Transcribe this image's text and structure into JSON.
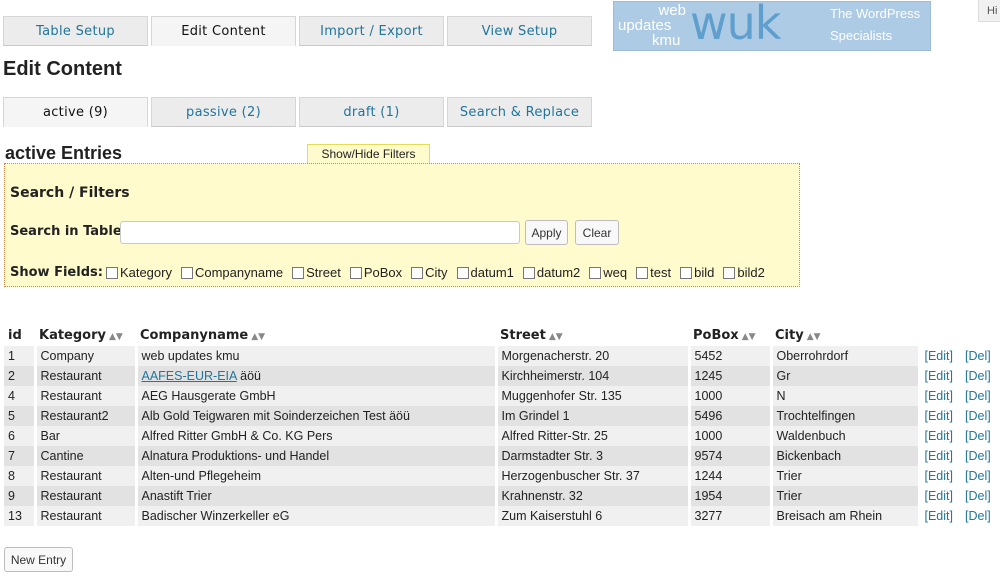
{
  "tabs_top": [
    "Table Setup",
    "Edit Content",
    "Import / Export",
    "View Setup"
  ],
  "tabs_top_active": 1,
  "banner": {
    "logo_web": "web",
    "logo_updates": "updates",
    "logo_kmu": "kmu",
    "logo_wuk": "wuk",
    "tagline_1": "The WordPress",
    "tagline_2": "Specialists"
  },
  "hide_label": "Hi",
  "page_title": "Edit Content",
  "tabs_sub": [
    "active (9)",
    "passive (2)",
    "draft (1)",
    "Search & Replace"
  ],
  "tabs_sub_active": 0,
  "section_title": "active Entries",
  "toggle_filters": "Show/Hide Filters",
  "filters": {
    "heading": "Search / Filters",
    "search_label": "Search in Table:",
    "search_value": "",
    "apply": "Apply",
    "clear": "Clear",
    "fields_label": "Show Fields:",
    "fields": [
      "Kategory",
      "Companyname",
      "Street",
      "PoBox",
      "City",
      "datum1",
      "datum2",
      "weq",
      "test",
      "bild",
      "bild2"
    ]
  },
  "table": {
    "headers": [
      "id",
      "Kategory",
      "Companyname",
      "Street",
      "PoBox",
      "City"
    ],
    "sortable": [
      false,
      true,
      true,
      true,
      true,
      true
    ],
    "edit_label": "[Edit]",
    "del_label": "[Del]",
    "rows": [
      {
        "id": "1",
        "kategory": "Company",
        "company": "web updates kmu",
        "company_link": "",
        "street": "Morgenacherstr. 20",
        "pobox": "5452",
        "city": "Oberrohrdorf"
      },
      {
        "id": "2",
        "kategory": "Restaurant",
        "company": " äöü",
        "company_link": "AAFES-EUR-EIA",
        "street": "Kirchheimerstr. 104",
        "pobox": "1245",
        "city": "Gr"
      },
      {
        "id": "4",
        "kategory": "Restaurant",
        "company": "AEG Hausgerate GmbH",
        "company_link": "",
        "street": "Muggenhofer Str. 135",
        "pobox": "1000",
        "city": "N"
      },
      {
        "id": "5",
        "kategory": "Restaurant2",
        "company": "Alb Gold Teigwaren mit Soinderzeichen Test äöü",
        "company_link": "",
        "street": "Im Grindel 1",
        "pobox": "5496",
        "city": "Trochtelfingen"
      },
      {
        "id": "6",
        "kategory": "Bar",
        "company": "Alfred Ritter GmbH & Co. KG Pers",
        "company_link": "",
        "street": "Alfred Ritter-Str. 25",
        "pobox": "1000",
        "city": "Waldenbuch"
      },
      {
        "id": "7",
        "kategory": "Cantine",
        "company": "Alnatura Produktions- und Handel",
        "company_link": "",
        "street": "Darmstadter Str. 3",
        "pobox": "9574",
        "city": "Bickenbach"
      },
      {
        "id": "8",
        "kategory": "Restaurant",
        "company": "Alten-und Pflegeheim",
        "company_link": "",
        "street": "Herzogenbuscher Str. 37",
        "pobox": "1244",
        "city": "Trier"
      },
      {
        "id": "9",
        "kategory": "Restaurant",
        "company": "Anastift Trier",
        "company_link": "",
        "street": "Krahnenstr. 32",
        "pobox": "1954",
        "city": "Trier"
      },
      {
        "id": "13",
        "kategory": "Restaurant",
        "company": "Badischer Winzerkeller eG",
        "company_link": "",
        "street": "Zum Kaiserstuhl 6",
        "pobox": "3277",
        "city": "Breisach am Rhein"
      }
    ]
  },
  "new_entry": "New Entry"
}
